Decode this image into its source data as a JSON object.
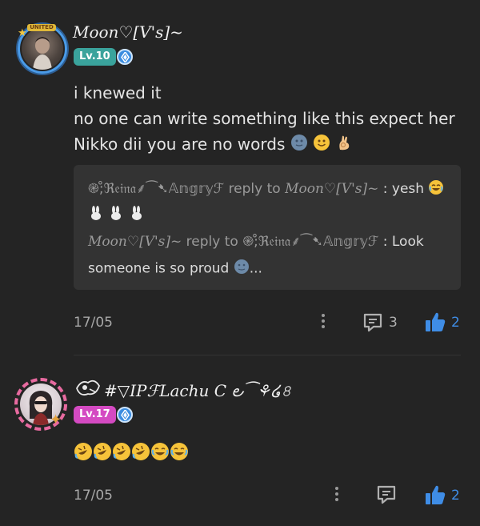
{
  "comments": [
    {
      "username": "Moon♡[V's]~",
      "level": "Lv.10",
      "badge_color": "#3aa39c",
      "text_lines": [
        "i knewed it",
        "no one can write something like this expect her",
        "Nikko dii you are no words"
      ],
      "frame_label": "UNITED",
      "replies": [
        {
          "from": "֎;̊ℜ𝔢𝔦𝔫𝔞⸙⁀➷𝔸𝕟𝕘𝕣𝕪ℱ",
          "to_text": "reply to",
          "to": "Moon♡[V's]~",
          "message": ": yesh"
        },
        {
          "from": "Moon♡[V's]~",
          "to_text": "reply to",
          "to": "֎;̊ℜ𝔢𝔦𝔫𝔞⸙⁀➷𝔸𝕟𝕘𝕣𝕪ℱ",
          "message": ": Look",
          "message_line2": "someone is so proud",
          "ellipsis": "..."
        }
      ],
      "date": "17/05",
      "reply_count": "3",
      "like_count": "2"
    },
    {
      "username": "#▽IPℱLachu C ౿⁀⚘໒৪",
      "level": "Lv.17",
      "badge_color": "#d44ac2",
      "date": "17/05",
      "like_count": "2"
    }
  ],
  "icons": {
    "verify": "verify-badge-icon",
    "more": "more-vertical-icon",
    "comment": "comment-icon",
    "like": "thumbs-up-icon"
  },
  "colors": {
    "accent": "#3f8de6",
    "background": "#242424"
  }
}
